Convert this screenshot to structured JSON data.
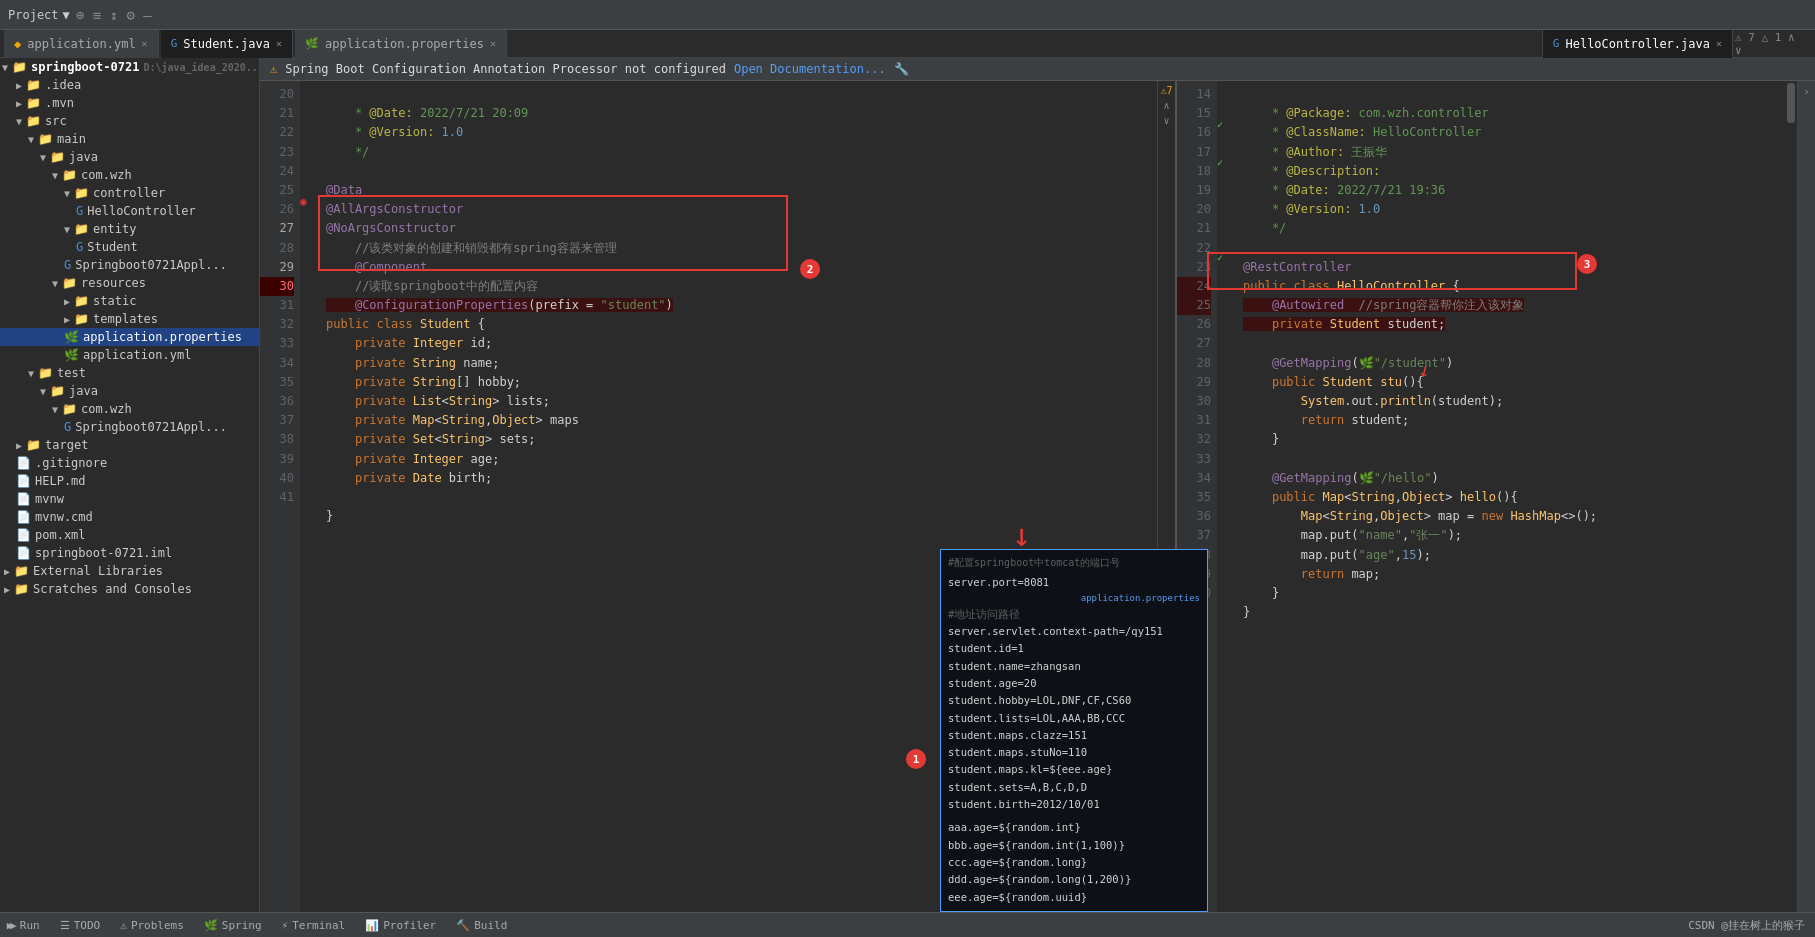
{
  "topbar": {
    "project_label": "Project",
    "dropdown_arrow": "▼"
  },
  "tabs": [
    {
      "label": "application.yml",
      "icon": "yml",
      "active": false
    },
    {
      "label": "Student.java",
      "icon": "java",
      "active": true
    },
    {
      "label": "application.properties",
      "icon": "props",
      "active": false
    },
    {
      "label": "HelloController.java",
      "icon": "java",
      "active": false
    }
  ],
  "sidebar": {
    "root": "springboot-0721",
    "root_path": "D:\\java_idea_2020",
    "items": [
      {
        "label": ".idea",
        "indent": 1,
        "type": "folder",
        "expanded": false
      },
      {
        "label": ".mvn",
        "indent": 1,
        "type": "folder",
        "expanded": false
      },
      {
        "label": "src",
        "indent": 1,
        "type": "folder",
        "expanded": true
      },
      {
        "label": "main",
        "indent": 2,
        "type": "folder",
        "expanded": true
      },
      {
        "label": "java",
        "indent": 3,
        "type": "folder",
        "expanded": true
      },
      {
        "label": "com.wzh",
        "indent": 4,
        "type": "folder",
        "expanded": true
      },
      {
        "label": "controller",
        "indent": 5,
        "type": "folder",
        "expanded": true
      },
      {
        "label": "HelloController",
        "indent": 6,
        "type": "java-spring",
        "expanded": false
      },
      {
        "label": "entity",
        "indent": 5,
        "type": "folder",
        "expanded": true
      },
      {
        "label": "Student",
        "indent": 6,
        "type": "java-spring",
        "expanded": false
      },
      {
        "label": "Springboot0721Appl...",
        "indent": 5,
        "type": "java-spring"
      },
      {
        "label": "resources",
        "indent": 4,
        "type": "folder",
        "expanded": true
      },
      {
        "label": "static",
        "indent": 5,
        "type": "folder"
      },
      {
        "label": "templates",
        "indent": 5,
        "type": "folder"
      },
      {
        "label": "application.properties",
        "indent": 5,
        "type": "props",
        "selected": true
      },
      {
        "label": "application.yml",
        "indent": 5,
        "type": "yml"
      },
      {
        "label": "test",
        "indent": 2,
        "type": "folder",
        "expanded": true
      },
      {
        "label": "java",
        "indent": 3,
        "type": "folder",
        "expanded": true
      },
      {
        "label": "com.wzh",
        "indent": 4,
        "type": "folder",
        "expanded": true
      },
      {
        "label": "Springboot0721Appl...",
        "indent": 5,
        "type": "java-spring"
      },
      {
        "label": "target",
        "indent": 1,
        "type": "folder",
        "expanded": false
      },
      {
        "label": ".gitignore",
        "indent": 1,
        "type": "git"
      },
      {
        "label": "HELP.md",
        "indent": 1,
        "type": "md"
      },
      {
        "label": "mvnw",
        "indent": 1,
        "type": "file"
      },
      {
        "label": "mvnw.cmd",
        "indent": 1,
        "type": "file"
      },
      {
        "label": "pom.xml",
        "indent": 1,
        "type": "xml"
      },
      {
        "label": "springboot-0721.iml",
        "indent": 1,
        "type": "iml"
      },
      {
        "label": "External Libraries",
        "indent": 0,
        "type": "folder",
        "expanded": false
      },
      {
        "label": "Scratches and Consoles",
        "indent": 0,
        "type": "folder",
        "expanded": false
      }
    ]
  },
  "warning_bar": {
    "icon": "⚠",
    "text": "Spring Boot Configuration Annotation Processor not configured",
    "link": "Open Documentation...",
    "tool_icon": "🔧"
  },
  "left_editor": {
    "filename": "Student.java",
    "lines": [
      {
        "num": 20,
        "code": "    * <span class='ann'>@Date:</span> <span class='str'>2022/7/21 20:09</span>"
      },
      {
        "num": 21,
        "code": "    * <span class='ann'>@Version:</span> <span class='num'>1.0</span>"
      },
      {
        "num": 22,
        "code": "    */"
      },
      {
        "num": 23,
        "code": ""
      },
      {
        "num": 24,
        "code": "<span class='kw2'>@Data</span>"
      },
      {
        "num": 25,
        "code": "<span class='kw2'>@AllArgsConstructor</span>"
      },
      {
        "num": 26,
        "code": "<span class='kw2'>@NoArgsConstructor</span>"
      },
      {
        "num": 27,
        "code": "    <span class='cmt'>//该类对象的创建和销毁都有spring容器来管理</span>"
      },
      {
        "num": 28,
        "code": "    <span class='kw2'>@Component</span>"
      },
      {
        "num": 29,
        "code": "    <span class='cmt'>//读取springboot中的配置内容</span>"
      },
      {
        "num": 30,
        "code": "    <span class='kw2'>@ConfigurationProperties</span>(<span class='plain'>prefix = </span><span class='str'>\"student\"</span>)"
      },
      {
        "num": 31,
        "code": "<span class='kw'>public class</span> <span class='type'>Student</span> {"
      },
      {
        "num": 32,
        "code": "    <span class='kw'>private</span> <span class='type'>Integer</span> id;"
      },
      {
        "num": 33,
        "code": "    <span class='kw'>private</span> <span class='type'>String</span> name;"
      },
      {
        "num": 34,
        "code": "    <span class='kw'>private</span> <span class='type'>String</span>[] hobby;"
      },
      {
        "num": 35,
        "code": "    <span class='kw'>private</span> <span class='type'>List</span>&lt;<span class='type'>String</span>&gt; lists;"
      },
      {
        "num": 36,
        "code": "    <span class='kw'>private</span> <span class='type'>Map</span>&lt;<span class='type'>String</span>,<span class='type'>Object</span>&gt; maps"
      },
      {
        "num": 37,
        "code": "    <span class='kw'>private</span> <span class='type'>Set</span>&lt;<span class='type'>String</span>&gt; sets;"
      },
      {
        "num": 38,
        "code": "    <span class='kw'>private</span> <span class='type'>Integer</span> age;"
      },
      {
        "num": 39,
        "code": "    <span class='kw'>private</span> <span class='type'>Date</span> birth;"
      },
      {
        "num": 40,
        "code": ""
      },
      {
        "num": 41,
        "code": "}"
      }
    ]
  },
  "right_editor": {
    "filename": "HelloController.java",
    "lines": [
      {
        "num": 14,
        "code": "    * <span class='ann'>@Package:</span> <span class='str'>com.wzh.controller</span>"
      },
      {
        "num": 15,
        "code": "    * <span class='ann'>@ClassName:</span> <span class='str'>HelloController</span>"
      },
      {
        "num": 16,
        "code": "    * <span class='ann'>@Author:</span> <span class='str'>王振华</span>"
      },
      {
        "num": 17,
        "code": "    * <span class='ann'>@Description:</span>"
      },
      {
        "num": 18,
        "code": "    * <span class='ann'>@Date:</span> <span class='str'>2022/7/21 19:36</span>"
      },
      {
        "num": 19,
        "code": "    * <span class='ann'>@Version:</span> <span class='num'>1.0</span>"
      },
      {
        "num": 20,
        "code": "    */"
      },
      {
        "num": 21,
        "code": ""
      },
      {
        "num": 22,
        "code": "<span class='kw2'>@RestController</span>"
      },
      {
        "num": 23,
        "code": "<span class='kw'>public class</span> <span class='type'>HelloController</span> {"
      },
      {
        "num": 24,
        "code": "    <span class='kw2'>@Autowired</span>  <span class='cmt'>//spring容器帮你注入该对象</span>"
      },
      {
        "num": 25,
        "code": "    <span class='kw'>private</span> <span class='type'>Student</span> student;"
      },
      {
        "num": 26,
        "code": ""
      },
      {
        "num": 27,
        "code": "    <span class='kw2'>@GetMapping</span>(<span class='str'>\"/student\"</span>)"
      },
      {
        "num": 28,
        "code": "    <span class='kw'>public</span> <span class='type'>Student</span> <span class='method'>stu</span>(){"
      },
      {
        "num": 29,
        "code": "        <span class='type'>System</span>.out.<span class='method'>println</span>(student);"
      },
      {
        "num": 30,
        "code": "        <span class='kw'>return</span> student;"
      },
      {
        "num": 31,
        "code": "    }"
      },
      {
        "num": 32,
        "code": ""
      },
      {
        "num": 33,
        "code": "    <span class='kw2'>@GetMapping</span>(<span class='str'>\"/hello\"</span>)"
      },
      {
        "num": 34,
        "code": "    <span class='kw'>public</span> <span class='type'>Map</span>&lt;<span class='type'>String</span>,<span class='type'>Object</span>&gt; <span class='method'>hello</span>(){"
      },
      {
        "num": 35,
        "code": "        <span class='type'>Map</span>&lt;<span class='type'>String</span>,<span class='type'>Object</span>&gt; map = <span class='kw'>new</span> <span class='type'>HashMap</span>&lt;&gt;();"
      },
      {
        "num": 36,
        "code": "        map.put(<span class='str'>\"name\"</span>,<span class='str'>\"张一\"</span>);"
      },
      {
        "num": 37,
        "code": "        map.put(<span class='str'>\"age\"</span>,<span class='num'>15</span>);"
      },
      {
        "num": 38,
        "code": "        <span class='kw'>return</span> map;"
      },
      {
        "num": 39,
        "code": "    }"
      },
      {
        "num": 40,
        "code": "}"
      }
    ]
  },
  "props_popup": {
    "header": "#配置springboot中tomcat的端口号",
    "lines": [
      "server.port=8081",
      "                        application.properties",
      "#地址访问路径",
      "server.servlet.context-path=/qy151",
      "student.id=1",
      "student.name=zhangsan",
      "student.age=20",
      "student.hobby=LOL,DNF,CF,CS60",
      "student.lists=LOL,AAA,BB,CCC",
      "student.maps.clazz=151",
      "student.maps.stuNo=110",
      "student.maps.kl=${eee.age}",
      "student.sets=A,B,C,D,D",
      "student.birth=2012/10/01",
      "",
      "aaa.age=${random.int}",
      "bbb.age=${random.int(1,100)}",
      "ccc.age=${random.long}",
      "ddd.age=${random.long(1,200)}",
      "eee.age=${random.uuid}"
    ]
  },
  "badges": {
    "badge1": "1",
    "badge2": "2",
    "badge3": "3"
  },
  "status_bar": {
    "run": "▶ Run",
    "todo": "☰ TODO",
    "problems": "⚠ Problems",
    "spring": "🌿 Spring",
    "terminal": "⚡ Terminal",
    "profiler": "📊 Profiler",
    "build": "🔨 Build",
    "right_text": "CSDN @挂在树上的猴子"
  }
}
